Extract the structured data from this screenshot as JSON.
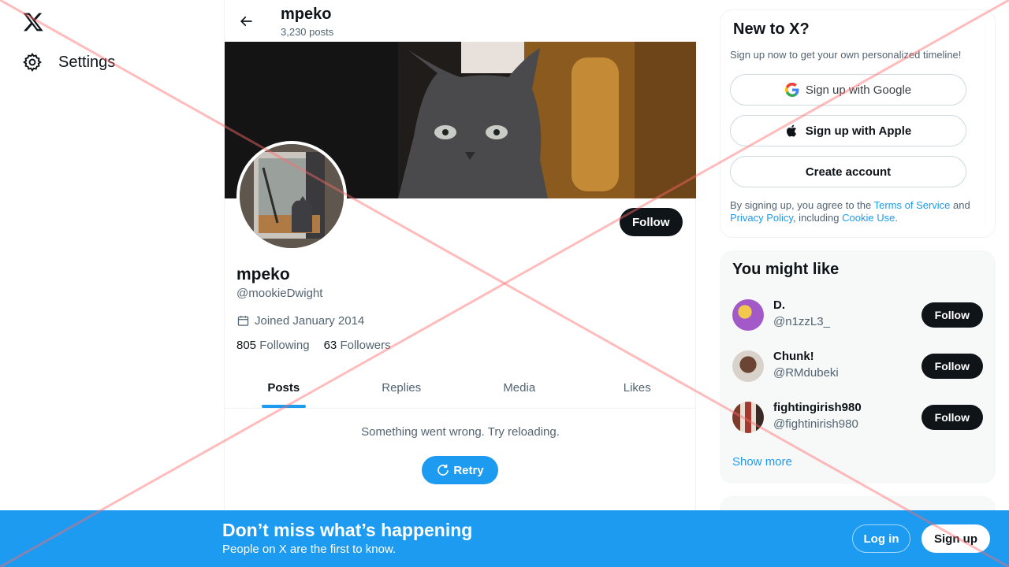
{
  "nav": {
    "settings_label": "Settings"
  },
  "profile": {
    "top_name": "mpeko",
    "post_count": "3,230 posts",
    "follow_label": "Follow",
    "name": "mpeko",
    "handle": "@mookieDwight",
    "joined": "Joined January 2014",
    "following_count": "805",
    "following_label": "Following",
    "followers_count": "63",
    "followers_label": "Followers"
  },
  "tabs": [
    {
      "label": "Posts",
      "active": true
    },
    {
      "label": "Replies",
      "active": false
    },
    {
      "label": "Media",
      "active": false
    },
    {
      "label": "Likes",
      "active": false
    }
  ],
  "feed": {
    "error_text": "Something went wrong. Try reloading.",
    "retry_label": "Retry"
  },
  "signup_card": {
    "title": "New to X?",
    "subtitle": "Sign up now to get your own personalized timeline!",
    "google_label": "Sign up with Google",
    "apple_label": "Sign up with Apple",
    "create_label": "Create account",
    "legal_prefix": "By signing up, you agree to the ",
    "terms": "Terms of Service",
    "legal_and": " and ",
    "privacy": "Privacy Policy",
    "legal_including": ", including ",
    "cookie": "Cookie Use",
    "legal_end": "."
  },
  "suggestions": {
    "title": "You might like",
    "show_more": "Show more",
    "items": [
      {
        "name": "D.",
        "handle": "@n1zzL3_",
        "follow": "Follow",
        "avatar_color": "#a35ac8"
      },
      {
        "name": "Chunk!",
        "handle": "@RMdubeki",
        "follow": "Follow",
        "avatar_color": "#5b3b2e"
      },
      {
        "name": "fightingirish980",
        "handle": "@fightinirish980",
        "follow": "Follow",
        "avatar_color": "#8a4a3a"
      }
    ]
  },
  "bottom_bar": {
    "title": "Don’t miss what’s happening",
    "subtitle": "People on X are the first to know.",
    "login_label": "Log in",
    "signup_label": "Sign up"
  },
  "colors": {
    "accent": "#1d9bf0",
    "dark": "#0f1419",
    "muted": "#536471",
    "overlay_x": "#ff6b6b"
  }
}
